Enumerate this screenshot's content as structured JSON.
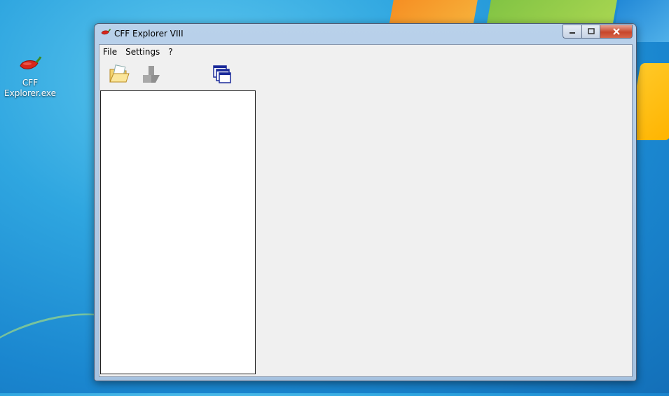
{
  "desktop": {
    "icon": {
      "label": "CFF Explorer.exe",
      "icon": "chili-pepper-icon"
    }
  },
  "window": {
    "title": "CFF Explorer VIII",
    "title_icon": "chili-pepper-icon",
    "caption_buttons": {
      "minimize": "minimize",
      "maximize": "maximize",
      "close": "close"
    }
  },
  "menubar": {
    "items": [
      {
        "label": "File"
      },
      {
        "label": "Settings"
      },
      {
        "label": "?"
      }
    ]
  },
  "toolbar": {
    "buttons": [
      {
        "icon": "open-folder-icon",
        "enabled": true
      },
      {
        "icon": "save-icon",
        "enabled": false
      },
      {
        "icon": "windows-cascade-icon",
        "enabled": true
      }
    ]
  },
  "colors": {
    "desktop": "#2fa6e0",
    "client_background": "#f0f0f0",
    "tree_background": "#ffffff"
  }
}
